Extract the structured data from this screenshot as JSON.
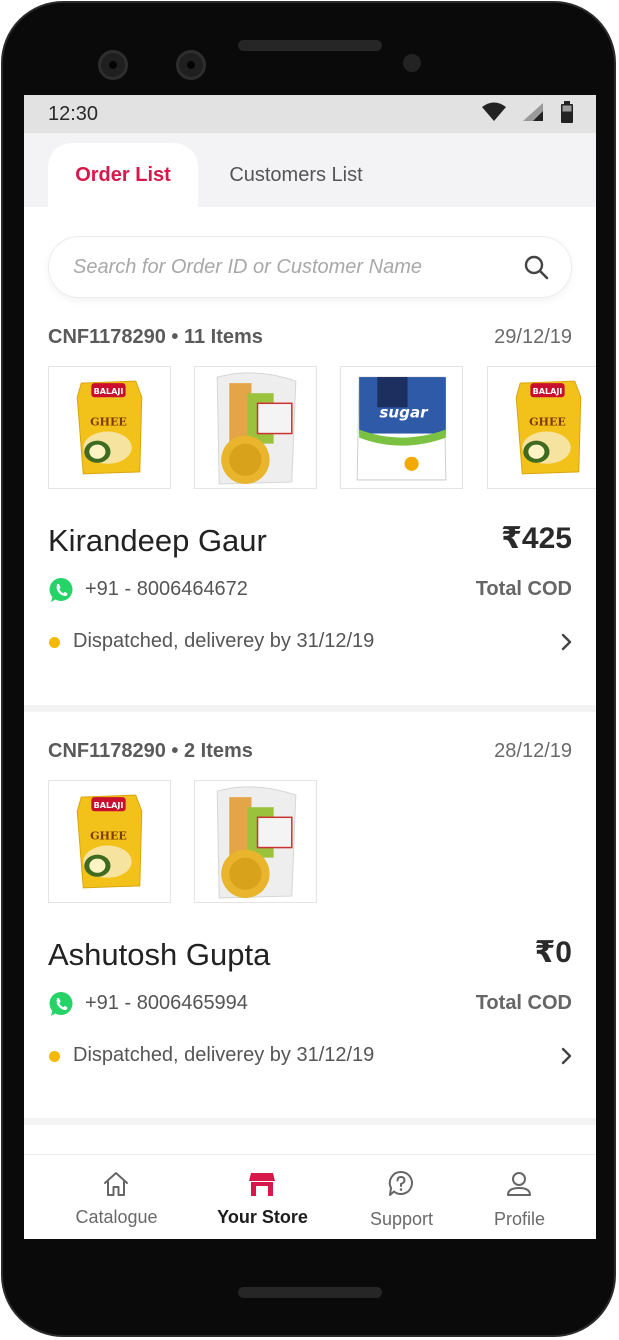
{
  "status_bar": {
    "time": "12:30"
  },
  "tabs": [
    {
      "label": "Order List",
      "active": true
    },
    {
      "label": "Customers List",
      "active": false
    }
  ],
  "search": {
    "placeholder": "Search for Order ID or Customer Name",
    "value": ""
  },
  "orders": [
    {
      "id_line": "CNF1178290 • 11 Items",
      "date": "29/12/19",
      "product_icons": [
        "ghee-pack",
        "mixed-grocery-bag",
        "sugar-pack",
        "ghee-pack"
      ],
      "customer": "Kirandeep Gaur",
      "amount": "₹425",
      "phone": "+91 - 8006464672",
      "payment": "Total COD",
      "status": "Dispatched, deliverey by 31/12/19"
    },
    {
      "id_line": "CNF1178290 • 2 Items",
      "date": "28/12/19",
      "product_icons": [
        "ghee-pack",
        "mixed-grocery-bag"
      ],
      "customer": "Ashutosh Gupta",
      "amount": "₹0",
      "phone": "+91 - 8006465994",
      "payment": "Total COD",
      "status": "Dispatched, deliverey by 31/12/19"
    }
  ],
  "bottom_nav": [
    {
      "label": "Catalogue",
      "icon": "home-icon",
      "active": false
    },
    {
      "label": "Your Store",
      "icon": "store-icon",
      "active": true
    },
    {
      "label": "Support",
      "icon": "help-icon",
      "active": false
    },
    {
      "label": "Profile",
      "icon": "user-icon",
      "active": false
    }
  ],
  "colors": {
    "accent": "#d7184a",
    "status_dot": "#f5b800",
    "whatsapp": "#25d366"
  }
}
